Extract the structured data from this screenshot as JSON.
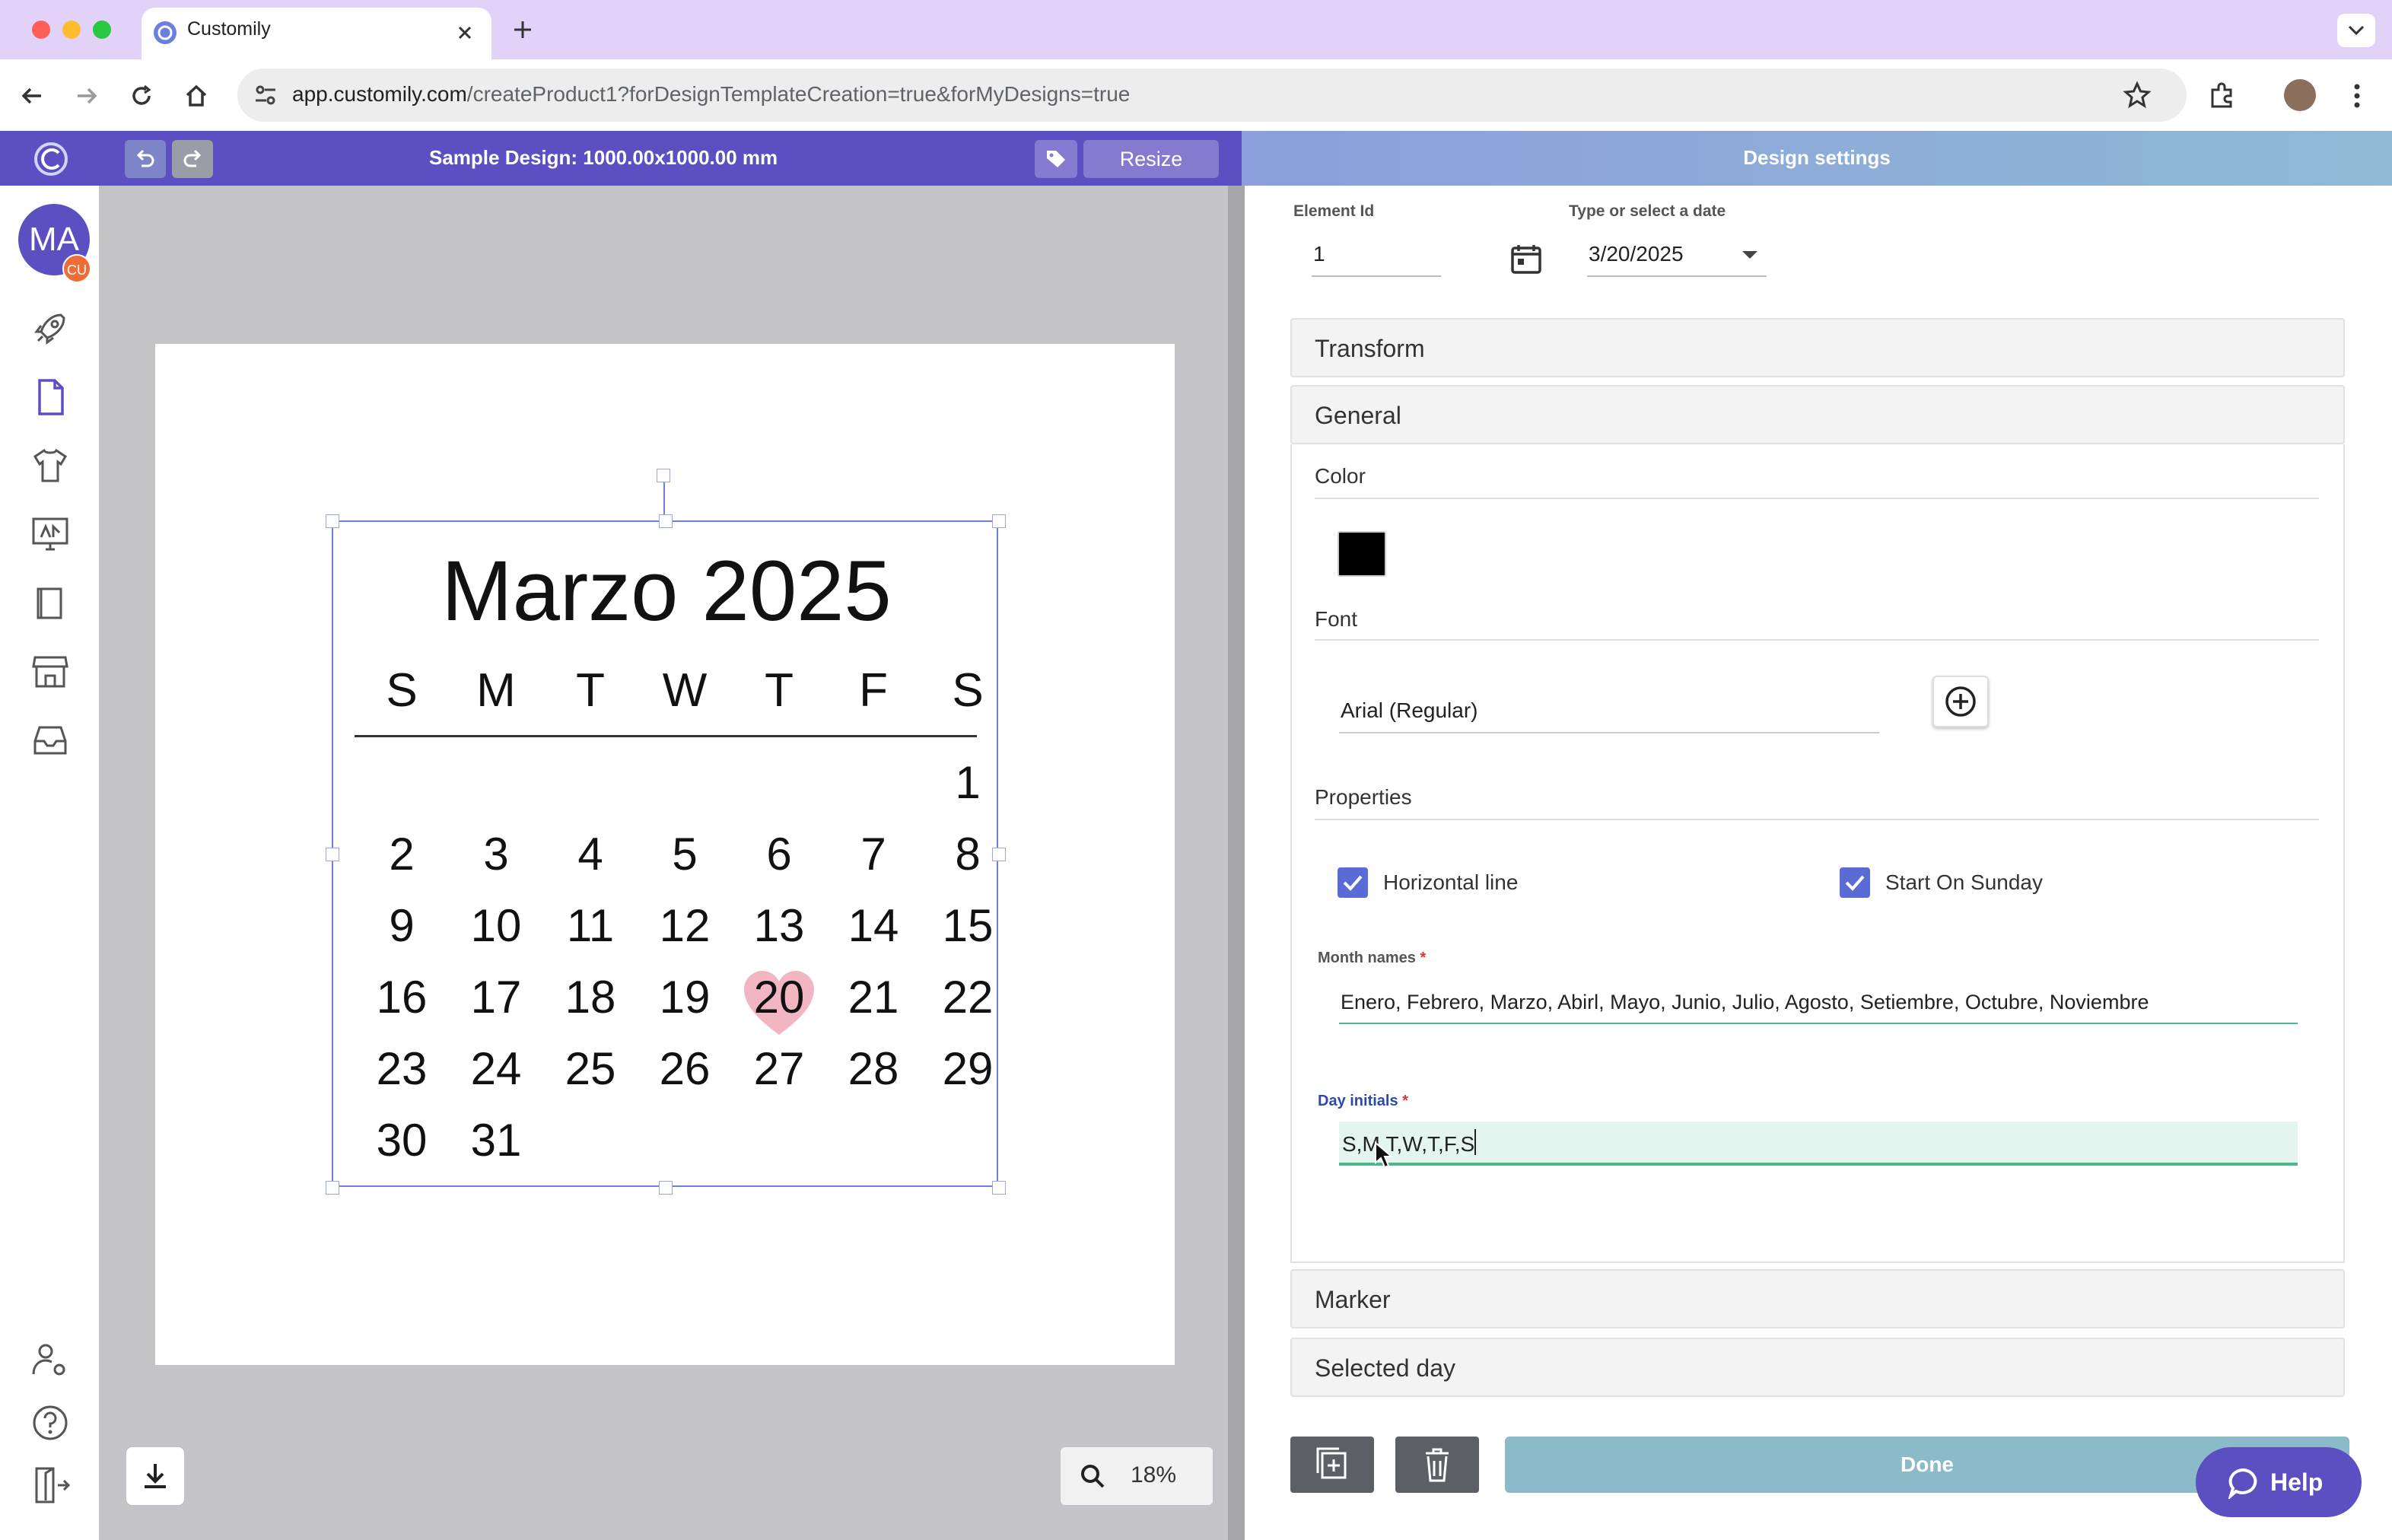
{
  "browser": {
    "tab_title": "Customily",
    "url_domain": "app.customily.com",
    "url_path": "/createProduct1?forDesignTemplateCreation=true&forMyDesigns=true"
  },
  "header": {
    "design_title": "Sample Design: 1000.00x1000.00 mm",
    "resize_label": "Resize",
    "settings_title": "Design settings"
  },
  "user": {
    "initials": "MA",
    "badge": "CU"
  },
  "calendar": {
    "title": "Marzo 2025",
    "day_initials": [
      "S",
      "M",
      "T",
      "W",
      "T",
      "F",
      "S"
    ],
    "weeks": [
      [
        "",
        "",
        "",
        "",
        "",
        "",
        "1"
      ],
      [
        "2",
        "3",
        "4",
        "5",
        "6",
        "7",
        "8"
      ],
      [
        "9",
        "10",
        "11",
        "12",
        "13",
        "14",
        "15"
      ],
      [
        "16",
        "17",
        "18",
        "19",
        "20",
        "21",
        "22"
      ],
      [
        "23",
        "24",
        "25",
        "26",
        "27",
        "28",
        "29"
      ],
      [
        "30",
        "31",
        "",
        "",
        "",
        "",
        ""
      ]
    ],
    "highlighted_day": "20",
    "highlight_color": "#f2b6c2"
  },
  "zoom": {
    "value": "18%"
  },
  "settings": {
    "element_id_label": "Element Id",
    "element_id_value": "1",
    "date_label": "Type or select a date",
    "date_value": "3/20/2025",
    "transform_label": "Transform",
    "general_label": "General",
    "color_label": "Color",
    "color_value": "#000000",
    "font_label": "Font",
    "font_value": "Arial (Regular)",
    "properties_label": "Properties",
    "horizontal_line_label": "Horizontal line",
    "start_on_sunday_label": "Start On Sunday",
    "month_names_label": "Month names",
    "month_names_value": "Enero, Febrero, Marzo, Abirl, Mayo, Junio, Julio, Agosto, Setiembre, Octubre, Noviembre",
    "day_initials_label": "Day initials",
    "day_initials_value": "S,M,T,W,T,F,S",
    "marker_label": "Marker",
    "selected_day_label": "Selected day",
    "done_label": "Done",
    "help_label": "Help"
  },
  "colors": {
    "brand": "#5b4fc2",
    "accent_check": "#5b6bd6",
    "done": "#8bbbc9"
  }
}
